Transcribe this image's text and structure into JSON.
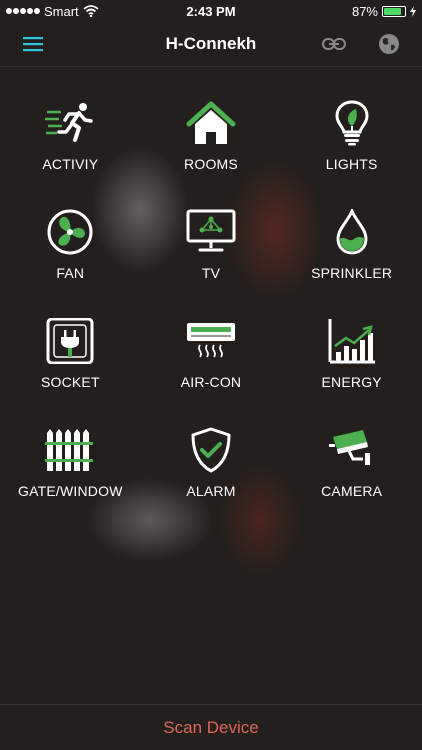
{
  "status_bar": {
    "carrier": "Smart",
    "time": "2:43 PM",
    "battery_text": "87%",
    "battery_level": 0.87
  },
  "nav": {
    "title": "H-Connekh"
  },
  "tiles": [
    {
      "label": "ACTIVIY",
      "icon": "running-person-icon"
    },
    {
      "label": "ROOMS",
      "icon": "house-icon"
    },
    {
      "label": "LIGHTS",
      "icon": "lightbulb-icon"
    },
    {
      "label": "FAN",
      "icon": "fan-icon"
    },
    {
      "label": "TV",
      "icon": "tv-icon"
    },
    {
      "label": "SPRINKLER",
      "icon": "water-drop-icon"
    },
    {
      "label": "SOCKET",
      "icon": "plug-socket-icon"
    },
    {
      "label": "AIR-CON",
      "icon": "air-conditioner-icon"
    },
    {
      "label": "ENERGY",
      "icon": "energy-chart-icon"
    },
    {
      "label": "GATE/WINDOW",
      "icon": "fence-icon"
    },
    {
      "label": "ALARM",
      "icon": "shield-check-icon"
    },
    {
      "label": "CAMERA",
      "icon": "security-camera-icon"
    }
  ],
  "bottom": {
    "scan_label": "Scan Device"
  },
  "colors": {
    "accent_green": "#4caf50",
    "menu_cyan": "#2ec4e6",
    "scan_red": "#e2645a"
  }
}
